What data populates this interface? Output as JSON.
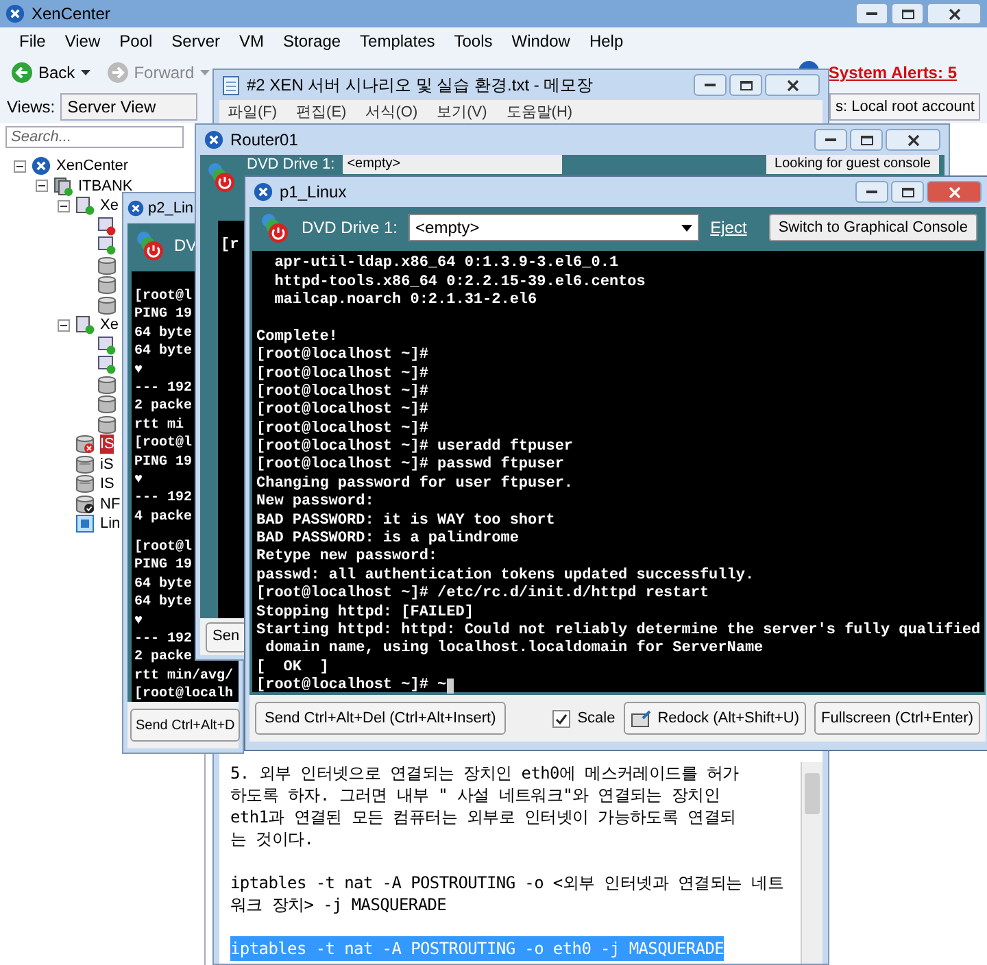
{
  "xencenter": {
    "title": "XenCenter",
    "menu": [
      "File",
      "View",
      "Pool",
      "Server",
      "VM",
      "Storage",
      "Templates",
      "Tools",
      "Window",
      "Help"
    ],
    "back": "Back",
    "forward": "Forward",
    "alerts": "System Alerts: 5",
    "views_label": "Views:",
    "views_value": "Server View",
    "account": "s: Local root account",
    "search": {
      "placeholder": "Search..."
    },
    "tree": [
      {
        "label": "XenCenter",
        "kind": "root",
        "expanded": true,
        "children": [
          {
            "label": "ITBANK",
            "kind": "pool",
            "expanded": true,
            "children": [
              {
                "label": "Xe",
                "kind": "host",
                "expanded": true,
                "children": [
                  {
                    "kind": "vm-stopped"
                  },
                  {
                    "kind": "vm-running"
                  },
                  {
                    "kind": "disk"
                  },
                  {
                    "kind": "disk"
                  },
                  {
                    "kind": "disk"
                  }
                ]
              },
              {
                "label": "Xe",
                "kind": "host",
                "expanded": true,
                "children": [
                  {
                    "kind": "vm-running"
                  },
                  {
                    "kind": "vm-running"
                  },
                  {
                    "kind": "disk"
                  },
                  {
                    "kind": "disk"
                  },
                  {
                    "kind": "disk"
                  }
                ]
              },
              {
                "label": "IS",
                "kind": "sr-broken",
                "selected": true
              },
              {
                "label": "iS",
                "kind": "sr",
                "selected": false
              },
              {
                "label": "IS",
                "kind": "sr",
                "selected": false
              },
              {
                "label": "NF",
                "kind": "sr-default",
                "selected": false
              },
              {
                "label": "Lin",
                "kind": "template",
                "selected": false
              }
            ]
          }
        ]
      }
    ]
  },
  "notepad": {
    "title": "#2 XEN 서버 시나리오 및 실습 환경.txt - 메모장",
    "menu": [
      "파일(F)",
      "편집(E)",
      "서식(O)",
      "보기(V)",
      "도움말(H)"
    ],
    "paragraphs": [
      {
        "lines": [
          {
            "text": "5. 외부 인터넷으로 연결되는 장치인 eth0에 메스커레이드를 허가",
            "selected": false
          },
          {
            "text": "하도록 하자. 그러면 내부 \" 사설 네트워크\"와 연결되는 장치인",
            "selected": false
          },
          {
            "text": "eth1과 연결된 모든 컴퓨터는 외부로 인터넷이 가능하도록 연결되",
            "selected": false
          },
          {
            "text": "는 것이다.",
            "selected": false
          }
        ]
      },
      {
        "lines": [
          {
            "text": "iptables -t nat -A POSTROUTING -o <외부 인터넷과 연결되는 네트",
            "selected": false
          },
          {
            "text": "워크 장치> -j MASQUERADE",
            "selected": false
          }
        ]
      },
      {
        "lines": [
          {
            "text": "iptables -t nat -A POSTROUTING -o eth0 -j MASQUERADE",
            "selected": true
          }
        ]
      }
    ]
  },
  "router": {
    "title": "Router01",
    "dvd_label": "DVD Drive 1:",
    "dvd_value": "<empty>",
    "console_button": "Looking for guest console",
    "console_lines": [
      "[r"
    ],
    "send": "Sen"
  },
  "p2": {
    "title": "p2_Lin",
    "dvd_label": "DV",
    "console_blocks": [
      [
        "[root@l",
        "PING 19",
        "64 byte",
        "64 byte",
        "♥",
        "--- 192",
        "2 packe",
        "rtt mi",
        "[root@l",
        "PING 19",
        "♥",
        "--- 192",
        "4 packe"
      ],
      [
        "[root@l",
        "PING 19",
        "64 byte",
        "64 byte",
        "♥",
        "--- 192",
        "2 packe",
        "rtt min/avg/",
        "[root@localh"
      ]
    ],
    "send": "Send Ctrl+Alt+D"
  },
  "p1": {
    "title": "p1_Linux",
    "dvd_label": "DVD Drive 1:",
    "dvd_value": "<empty>",
    "eject": "Eject",
    "switch": "Switch to Graphical Console",
    "console_blocks": [
      [
        "  apr-util-ldap.x86_64 0:1.3.9-3.el6_0.1",
        "  httpd-tools.x86_64 0:2.2.15-39.el6.centos",
        "  mailcap.noarch 0:2.1.31-2.el6"
      ],
      [
        "Complete!",
        "[root@localhost ~]#",
        "[root@localhost ~]#",
        "[root@localhost ~]#",
        "[root@localhost ~]#",
        "[root@localhost ~]#",
        "[root@localhost ~]# useradd ftpuser",
        "[root@localhost ~]# passwd ftpuser",
        "Changing password for user ftpuser.",
        "New password:",
        "BAD PASSWORD: it is WAY too short",
        "BAD PASSWORD: is a palindrome",
        "Retype new password:",
        "passwd: all authentication tokens updated successfully.",
        "[root@localhost ~]# /etc/rc.d/init.d/httpd restart",
        "Stopping httpd: [FAILED]",
        "Starting httpd: httpd: Could not reliably determine the server's fully qualified",
        " domain name, using localhost.localdomain for ServerName",
        "[  OK  ]",
        "[root@localhost ~]# ~"
      ]
    ],
    "send": "Send Ctrl+Alt+Del (Ctrl+Alt+Insert)",
    "scale": {
      "label": "Scale",
      "checked": true
    },
    "redock": "Redock (Alt+Shift+U)",
    "fullscreen": "Fullscreen (Ctrl+Enter)"
  }
}
